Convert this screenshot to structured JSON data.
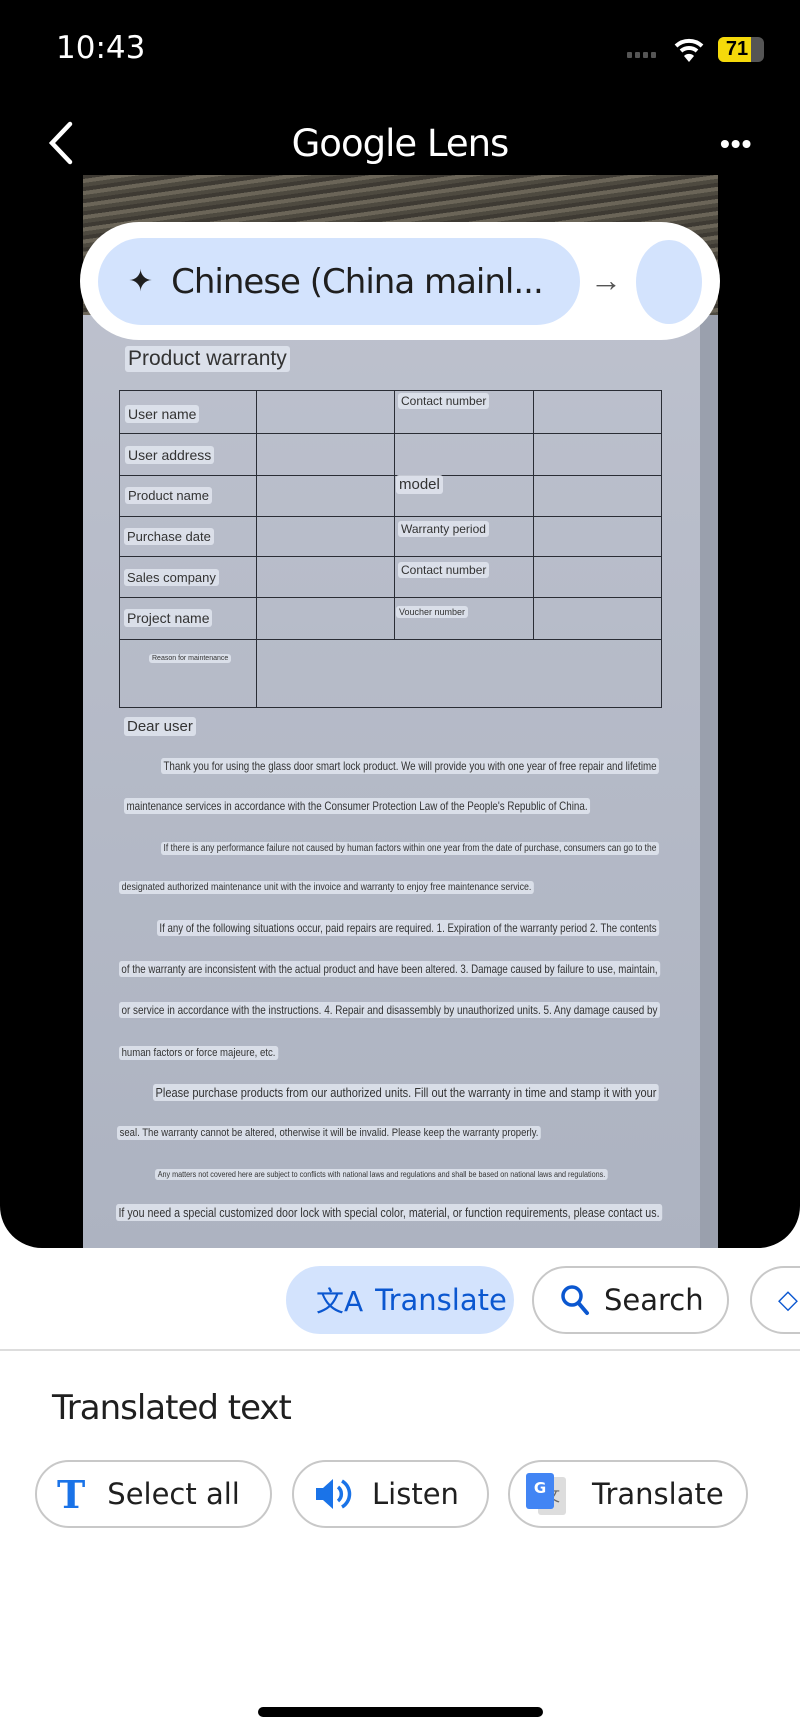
{
  "status_bar": {
    "time": "10:43",
    "battery": "71",
    "battery_level": 0.71,
    "battery_color": "#f5d90a"
  },
  "header": {
    "title": "Google Lens",
    "back_icon": "chevron-left-icon",
    "more_icon": "more-horizontal-icon"
  },
  "language_bar": {
    "source_language": "Chinese (China mainl...",
    "icon": "sparkle-icon",
    "arrow_icon": "arrow-right-icon"
  },
  "document": {
    "title": "Product warranty",
    "table_labels": [
      "User name",
      "Contact number",
      "User address",
      "Product name",
      "model",
      "Purchase date",
      "Warranty period",
      "Sales company",
      "Contact number",
      "Project name",
      "Voucher number",
      "Reason for maintenance"
    ],
    "greeting": "Dear user",
    "lines": [
      "Thank you for using the glass door smart lock product. We will provide you with one year of free repair and lifetime",
      "maintenance services in accordance with the Consumer Protection Law of the People's Republic of China.",
      "If there is any performance failure not caused by human factors within one year from the date of purchase, consumers can go to the",
      "designated authorized maintenance unit with the invoice and warranty to enjoy free maintenance service.",
      "If any of the following situations occur, paid repairs are required. 1. Expiration of the warranty period 2. The contents",
      "of the warranty are inconsistent with the actual product and have been altered. 3. Damage caused by failure to use, maintain,",
      "or service in accordance with the instructions. 4. Repair and disassembly by unauthorized units. 5. Any damage caused by",
      "human factors or force majeure, etc.",
      "Please purchase products from our authorized units. Fill out the warranty in time and stamp it with your",
      "seal. The warranty cannot be altered, otherwise it will be invalid. Please keep the warranty properly.",
      "Any matters not covered here are subject to conflicts with national laws and regulations and shall be based on national laws and regulations.",
      "If you need a special customized door lock with special color, material, or function requirements, please contact us."
    ]
  },
  "mode_chips": [
    {
      "label": "Translate",
      "icon": "translate-icon",
      "active": true
    },
    {
      "label": "Search",
      "icon": "search-icon"
    },
    {
      "label": "",
      "icon": "homework-icon"
    }
  ],
  "results": {
    "heading": "Translated text",
    "actions": [
      {
        "label": "Select all",
        "icon": "text-select-icon"
      },
      {
        "label": "Listen",
        "icon": "speaker-icon"
      },
      {
        "label": "Translate",
        "icon": "google-translate-icon"
      }
    ]
  },
  "colors": {
    "accent": "#0b57d0",
    "chip_active_bg": "#d3e3fd"
  }
}
